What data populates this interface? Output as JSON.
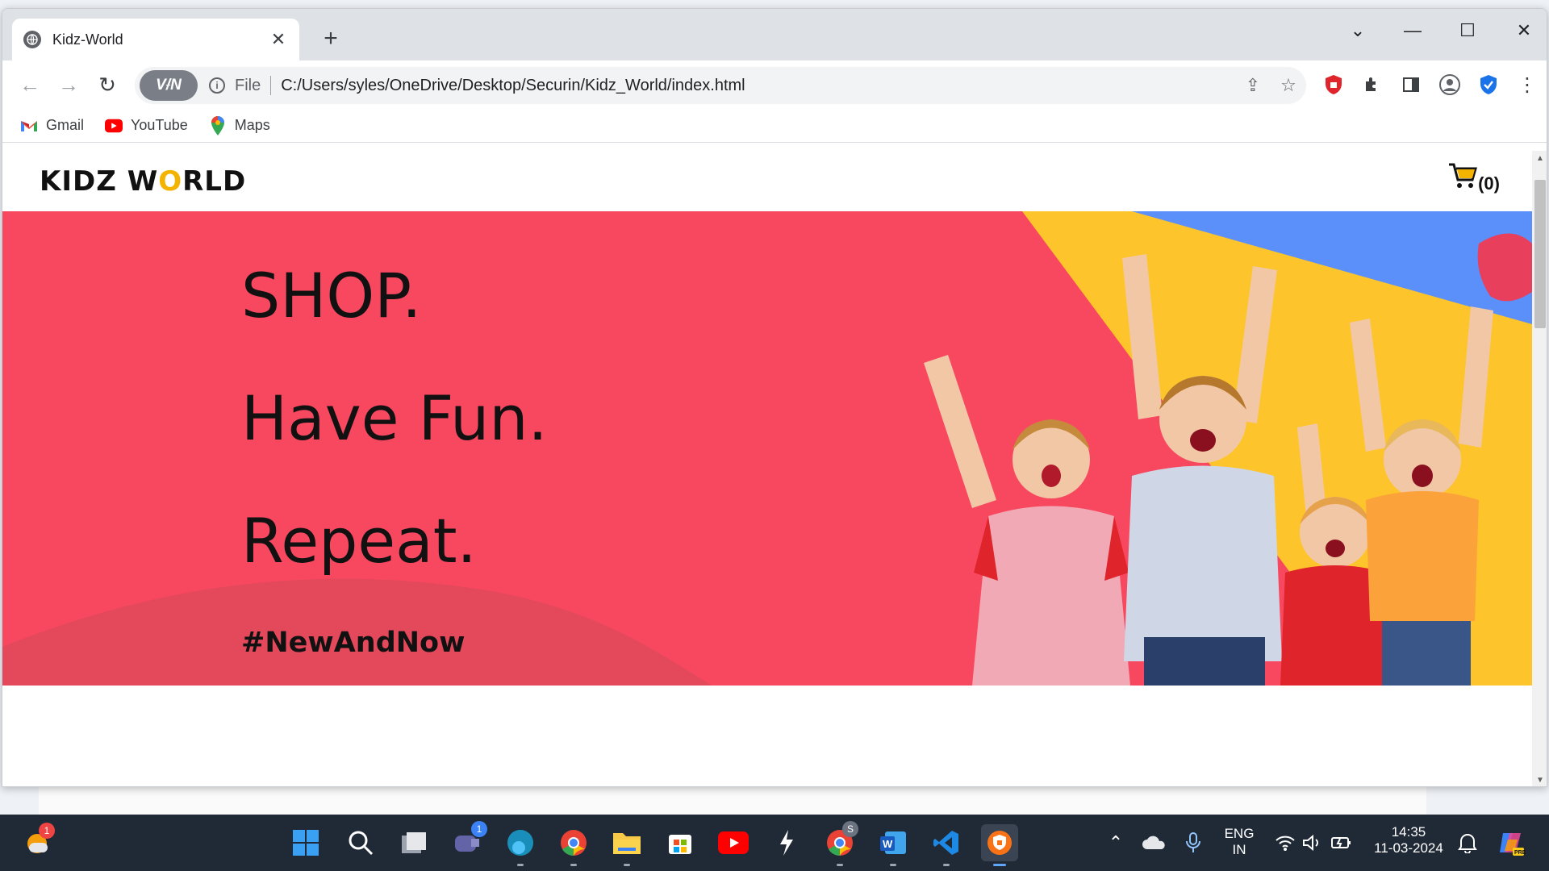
{
  "browser": {
    "tab_title": "Kidz-World",
    "url_scheme_label": "File",
    "url": "C:/Users/syles/OneDrive/Desktop/Securin/Kidz_World/index.html",
    "vpn_label": "VPN"
  },
  "bookmarks": [
    {
      "label": "Gmail",
      "icon": "gmail-icon"
    },
    {
      "label": "YouTube",
      "icon": "youtube-icon"
    },
    {
      "label": "Maps",
      "icon": "maps-icon"
    }
  ],
  "site": {
    "logo_pre": "KIDZ W",
    "logo_o": "O",
    "logo_post": "RLD",
    "cart_count": "(0)",
    "hero_lines": [
      "SHOP.",
      "Have Fun.",
      "Repeat."
    ],
    "hashtag": "#NewAndNow"
  },
  "taskbar": {
    "lang_top": "ENG",
    "lang_bottom": "IN",
    "time": "14:35",
    "date": "11-03-2024",
    "weather_badge": "1",
    "teams_badge": "1",
    "chrome_profile_badge": "S"
  },
  "colors": {
    "hero_red": "#f84860",
    "hero_yellow": "#fdc52b",
    "hero_blue": "#5b8ff9",
    "logo_accent": "#f5b301",
    "taskbar": "#202a36"
  }
}
